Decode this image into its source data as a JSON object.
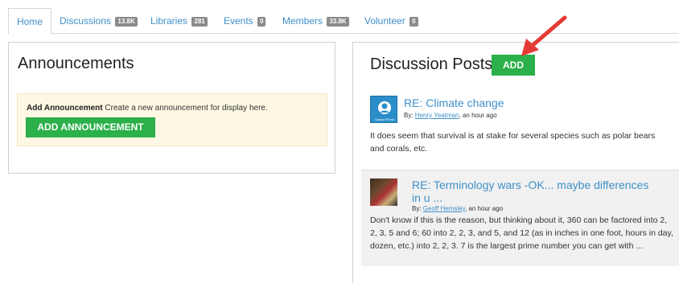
{
  "tabs": [
    {
      "label": "Home",
      "badge": null,
      "active": true
    },
    {
      "label": "Discussions",
      "badge": "13.8K"
    },
    {
      "label": "Libraries",
      "badge": "281"
    },
    {
      "label": "Events",
      "badge": "0"
    },
    {
      "label": "Members",
      "badge": "33.8K"
    },
    {
      "label": "Volunteer",
      "badge": "0"
    }
  ],
  "announcements": {
    "title": "Announcements",
    "prompt_bold": "Add Announcement",
    "prompt_text": "Create a new announcement for display here.",
    "button_label": "ADD ANNOUNCEMENT"
  },
  "discussion": {
    "title": "Discussion Posts",
    "add_label": "ADD",
    "posts": [
      {
        "title": "RE: Climate change",
        "by_label": "By:",
        "author": "Henry Yeatman",
        "time": ", an hour ago",
        "avatar_caption": "Upload Photo",
        "body": "It does seem that survival is at stake for several species such as polar bears and corals, etc."
      },
      {
        "title": "RE: Terminology wars -OK... maybe differences in u ...",
        "by_label": "By:",
        "author": "Geoff Hemsley",
        "time": ", an hour ago",
        "body": "Don't know if this is the reason, but thinking about it, 360 can be factored into 2, 2, 3, 5 and 6; 60 into 2, 2, 3, and 5, and 12 (as in inches in one foot, hours in day, dozen, etc.) into 2, 2, 3. 7 is the largest prime number you can get with ..."
      }
    ]
  },
  "colors": {
    "accent": "#3f8fc8",
    "button_green": "#2bb04a",
    "arrow_red": "#e53935",
    "announce_bg": "#fdf7e3"
  }
}
